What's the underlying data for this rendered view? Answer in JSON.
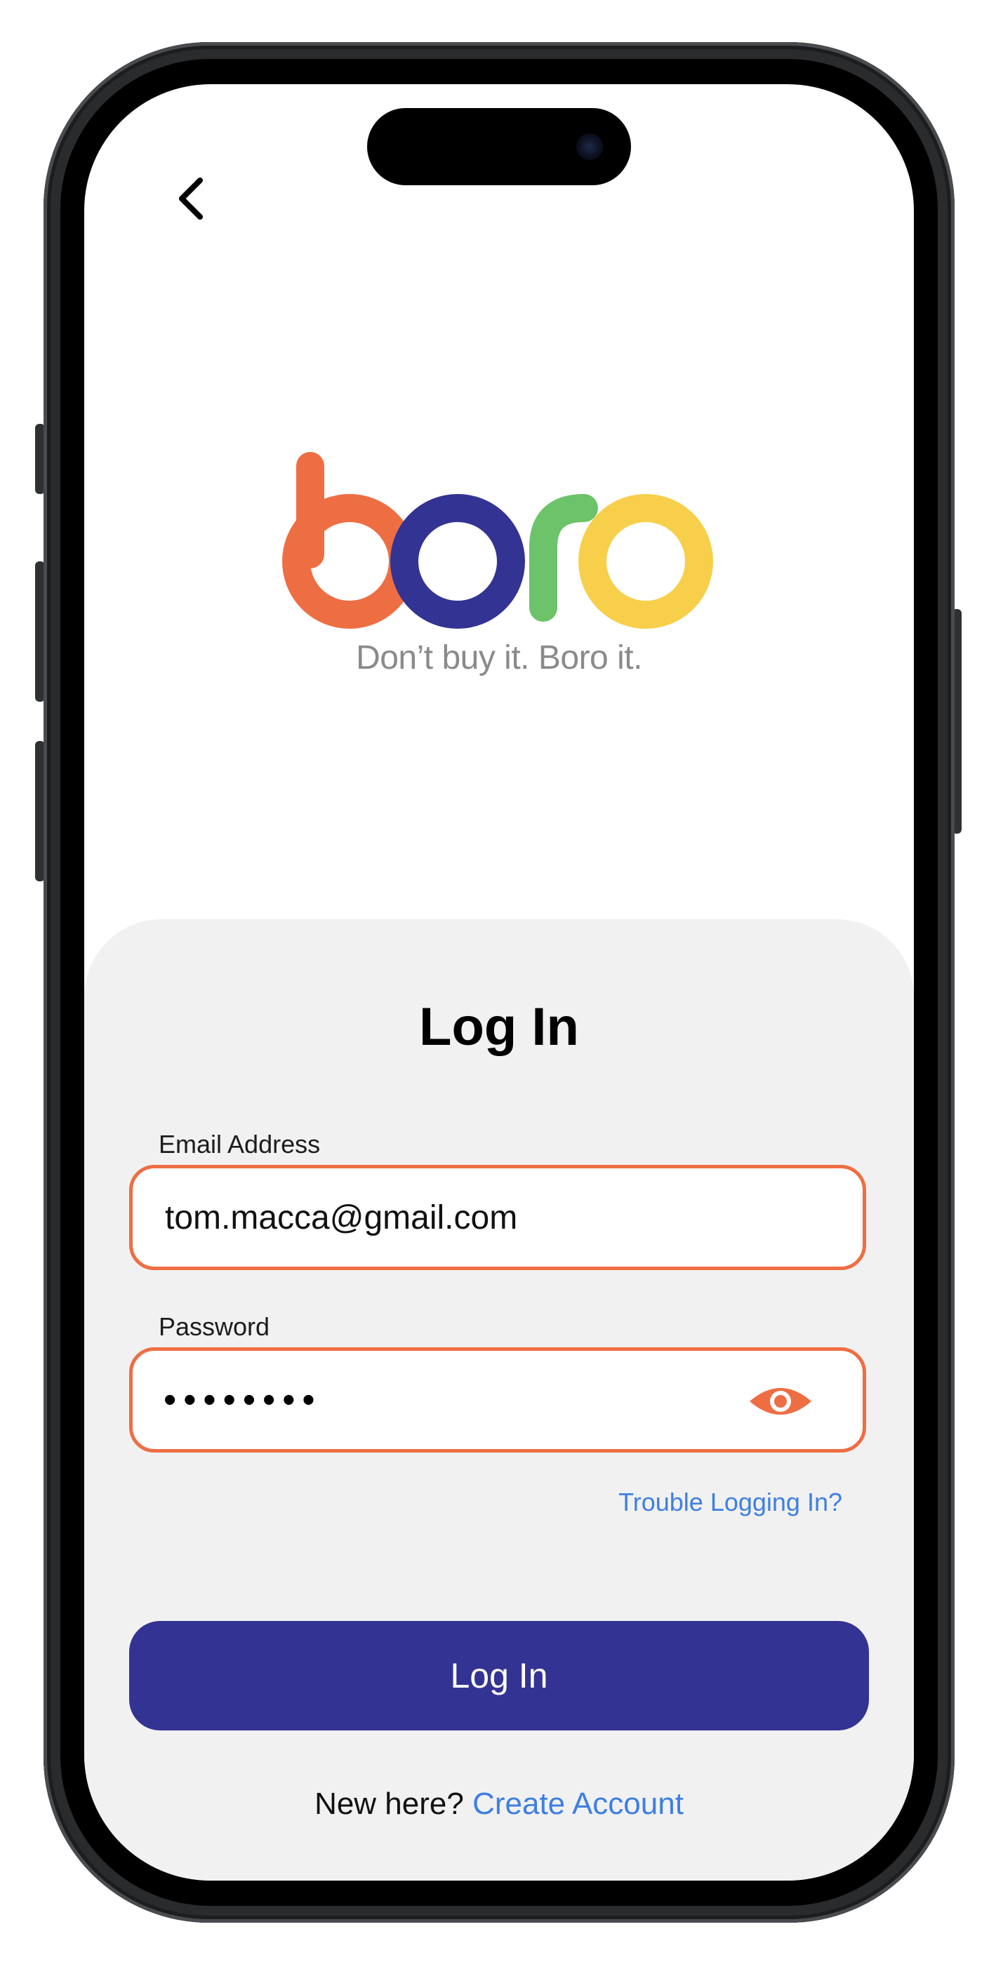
{
  "brand": {
    "logo_text": "boro",
    "tagline": "Don’t buy it. Boro it.",
    "colors": {
      "b": "#ee6e43",
      "o1": "#333393",
      "r": "#6cc36a",
      "o2": "#f7cf4a"
    }
  },
  "nav": {
    "back_icon": "chevron-left-icon"
  },
  "login": {
    "title": "Log In",
    "email": {
      "label": "Email Address",
      "value": "tom.macca@gmail.com"
    },
    "password": {
      "label": "Password",
      "masked_value": "••••••••",
      "toggle_icon": "eye-icon"
    },
    "trouble_link": "Trouble Logging In?",
    "submit_label": "Log In",
    "signup_prompt": "New here?",
    "signup_link": "Create Account"
  },
  "theme": {
    "accent": "#ee6e43",
    "primary": "#333393",
    "link": "#3f7fe0",
    "sheet_bg": "#f1f1f1"
  }
}
